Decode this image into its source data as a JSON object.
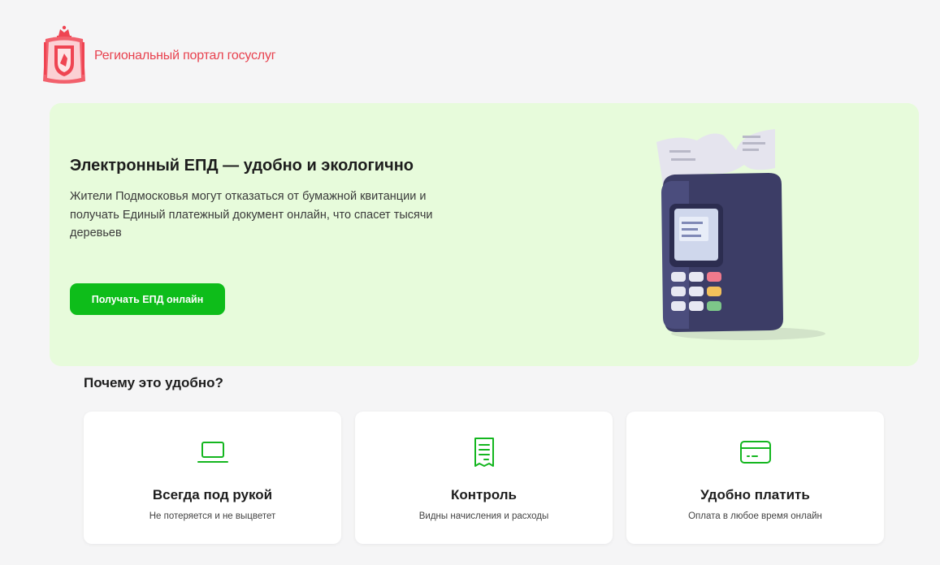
{
  "header": {
    "logo_icon": "moscow-oblast-coat-of-arms-icon",
    "portal_title": "Региональный портал госуслуг"
  },
  "hero": {
    "title": "Электронный ЕПД — удобно и экологично",
    "text": "Жители Подмосковья могут отказаться от бумажной квитанции и получать Единый платежный документ онлайн, что спасет тысячи деревьев",
    "button_label": "Получать ЕПД онлайн",
    "illustration": "payment-terminal-illustration"
  },
  "why": {
    "title": "Почему это удобно?"
  },
  "features": [
    {
      "icon": "laptop-icon",
      "title": "Всегда под рукой",
      "subtitle": "Не потеряется и не выцветет"
    },
    {
      "icon": "receipt-icon",
      "title": "Контроль",
      "subtitle": "Видны начисления и расходы"
    },
    {
      "icon": "credit-card-icon",
      "title": "Удобно платить",
      "subtitle": "Оплата в любое время онлайн"
    }
  ],
  "colors": {
    "brand_red": "#e8424f",
    "hero_bg": "#e7fbdb",
    "button_green": "#0ebd1a",
    "icon_green": "#14b61f",
    "page_bg": "#f5f5f6"
  }
}
